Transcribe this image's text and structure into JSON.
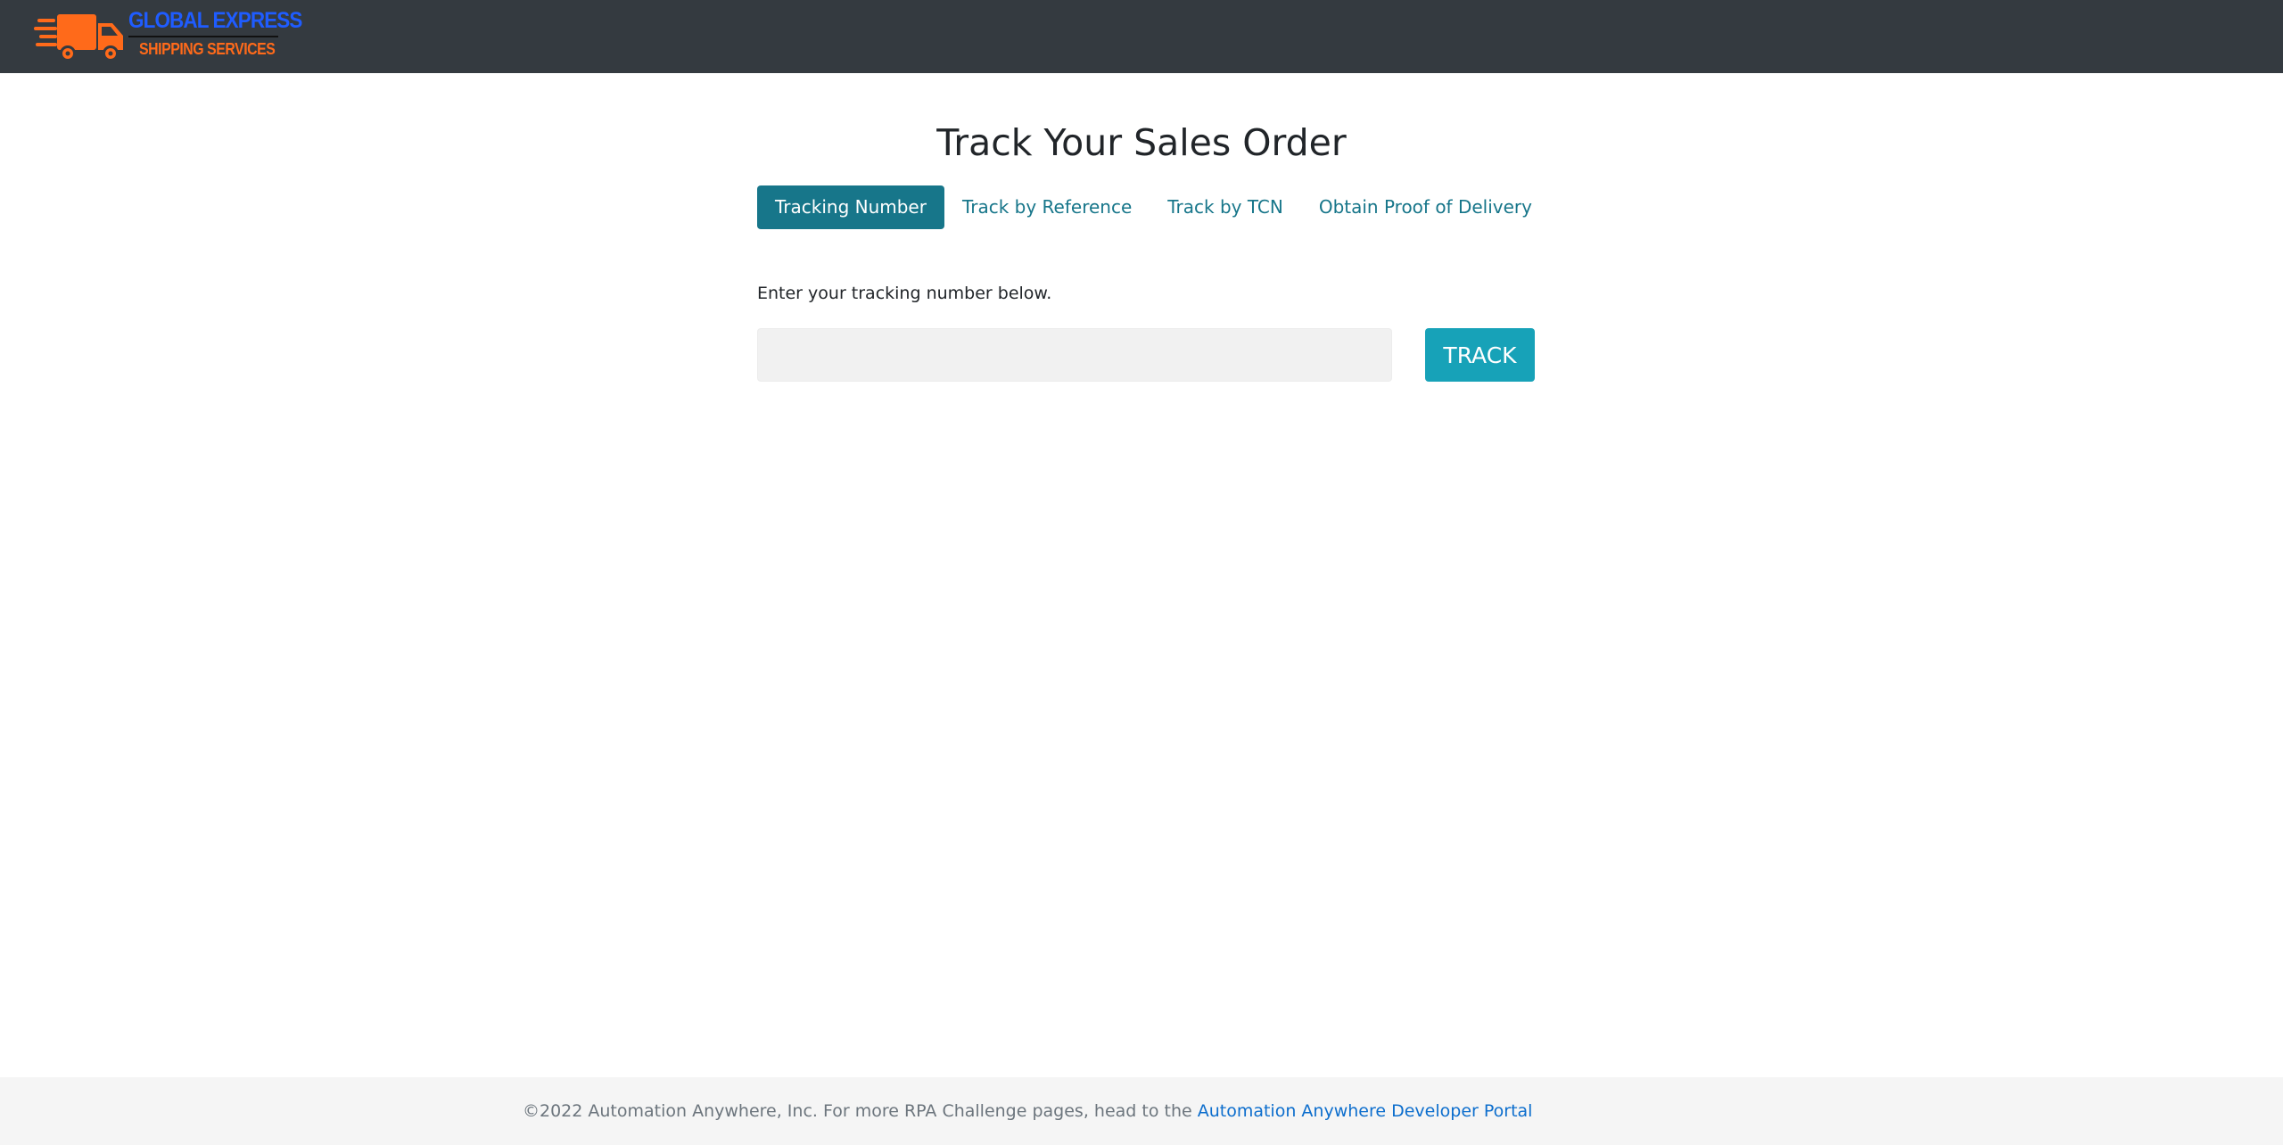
{
  "brand": {
    "line1": "GLOBAL EXPRESS",
    "line2": "SHIPPING SERVICES",
    "logo_icon": "delivery-truck-icon",
    "colors": {
      "primary": "#1f5cff",
      "accent": "#ff6a1a"
    }
  },
  "main": {
    "title": "Track Your Sales Order",
    "tabs": [
      {
        "label": "Tracking Number",
        "active": true
      },
      {
        "label": "Track by Reference",
        "active": false
      },
      {
        "label": "Track by TCN",
        "active": false
      },
      {
        "label": "Obtain Proof of Delivery",
        "active": false
      }
    ],
    "helper_text": "Enter your tracking number below.",
    "tracking_input": {
      "value": "",
      "placeholder": ""
    },
    "track_button_label": "TRACK"
  },
  "footer": {
    "text": "©2022 Automation Anywhere, Inc. For more RPA Challenge pages, head to the ",
    "link_label": "Automation Anywhere Developer Portal"
  },
  "colors": {
    "navbar": "#343a40",
    "tab_active": "#17768a",
    "track_button": "#17a2b8",
    "footer_link": "#0d6ecd"
  }
}
